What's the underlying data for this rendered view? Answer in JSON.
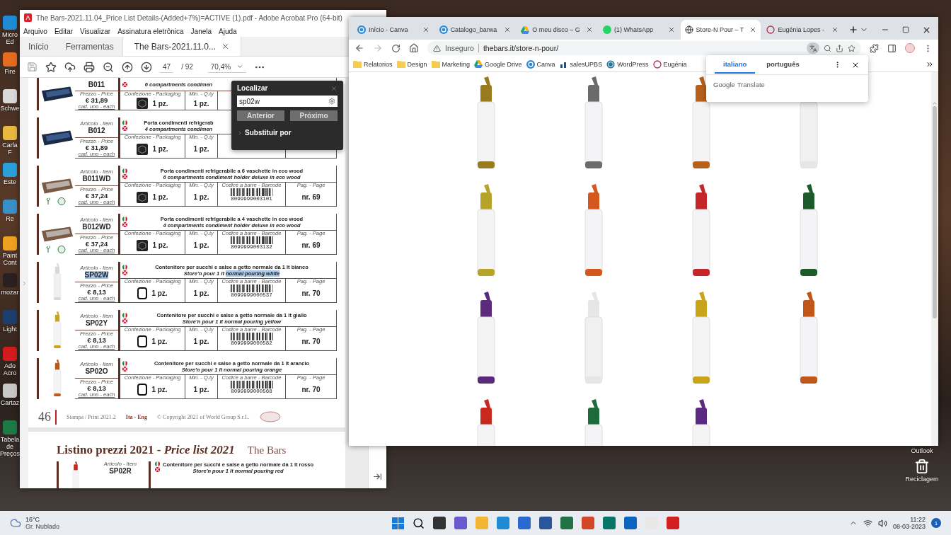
{
  "desktop": {
    "left_icons": [
      {
        "label": "Micro Ed",
        "color": "#1f8ad6"
      },
      {
        "label": "Fire",
        "color": "#e66a1f"
      },
      {
        "label": "Schwe",
        "color": "#d9d9d9"
      },
      {
        "label": "Carla F",
        "color": "#e8b840"
      },
      {
        "label": "Este",
        "color": "#2aa0d8"
      },
      {
        "label": "Re",
        "color": "#3a8fc8"
      },
      {
        "label": "Paint Cont",
        "color": "#f0a020"
      },
      {
        "label": "mozar",
        "color": "#2a2020"
      },
      {
        "label": "Light",
        "color": "#1c3f6e"
      },
      {
        "label": "Ado Acro",
        "color": "#d01c1c"
      },
      {
        "label": "Cartaz",
        "color": "#c8c8c8"
      },
      {
        "label": "Tabela de Preços",
        "color": "#1d7a45"
      }
    ],
    "right_icons": [
      {
        "label": "Outlook",
        "kind": "label"
      },
      {
        "label": "Reciclagem",
        "kind": "bin"
      }
    ]
  },
  "acrobat": {
    "title": "The Bars-2021.11.04_Price List Details-(Added+7%)=ACTIVE (1).pdf - Adobe Acrobat Pro (64-bit)",
    "menu": [
      "Arquivo",
      "Editar",
      "Visualizar",
      "Assinatura eletrônica",
      "Janela",
      "Ajuda"
    ],
    "tabs": [
      {
        "label": "Início",
        "selected": false
      },
      {
        "label": "Ferramentas",
        "selected": false
      },
      {
        "label": "The Bars-2021.11.0...",
        "selected": true
      }
    ],
    "toolbar": {
      "page": "47",
      "pages": "/ 92",
      "zoom": "70,4%"
    },
    "find": {
      "title": "Localizar",
      "value": "sp02w",
      "buttons": [
        "Anterior",
        "Próximo"
      ],
      "replace": "Substituir por"
    },
    "rows": [
      {
        "kind": "tray",
        "code": "B011",
        "code_highlighted": false,
        "price_label": "Prezzo - Price",
        "price": "€ 31,89",
        "each": "cad. uno - each",
        "desc_en": "6 compartments condimen",
        "pack_label": "Confezione - Packaging",
        "pack": "1 pz.",
        "min_label": "Min. - Q.ty",
        "min": "1 pz."
      },
      {
        "kind": "tray",
        "item_label": "Articolo - Item",
        "code": "B012",
        "code_highlighted": false,
        "price_label": "Prezzo - Price",
        "price": "€ 31,89",
        "each": "cad. uno - each",
        "desc_it": "Porta condimenti refrigerab",
        "desc_en": "4 compartments condimen",
        "pack_label": "Confezione - Packaging",
        "pack": "1 pz.",
        "min_label": "Min. - Q.ty",
        "min": "1 pz."
      },
      {
        "kind": "wood-tray",
        "item_label": "Articolo - Item",
        "code": "B011WD",
        "code_highlighted": false,
        "price_label": "Prezzo - Price",
        "price": "€ 37,24",
        "each": "cad. uno - each",
        "desc_it": "Porta condimenti refrigerabile a 6 vaschette in eco wood",
        "desc_en": "6 compartments condiment holder deluxe in eco wood",
        "pack_label": "Confezione - Packaging",
        "pack": "1 pz.",
        "min_label": "Min. - Q.ty",
        "min": "1 pz.",
        "barcode_label": "Codice a barre - Barcode",
        "barcode": "8099999003101",
        "page_label": "Pag. - Page",
        "page": "nr. 69"
      },
      {
        "kind": "wood-tray",
        "item_label": "Articolo - Item",
        "code": "B012WD",
        "code_highlighted": false,
        "price_label": "Prezzo - Price",
        "price": "€ 37,24",
        "each": "cad. uno - each",
        "desc_it": "Porta condimenti refrigerabile a 4 vaschette in eco wood",
        "desc_en": "4 compartments condiment holder deluxe in eco wood",
        "pack_label": "Confezione - Packaging",
        "pack": "1 pz.",
        "min_label": "Min. - Q.ty",
        "min": "1 pz.",
        "barcode_label": "Codice a barre - Barcode",
        "barcode": "8099999003132",
        "page_label": "Pag. - Page",
        "page": "nr. 69"
      },
      {
        "kind": "bottle",
        "color": "#d8d8d8",
        "item_label": "Articolo - Item",
        "code": "SP02W",
        "code_highlighted": true,
        "price_label": "Prezzo - Price",
        "price": "€ 8,13",
        "each": "cad. uno - each",
        "desc_it": "Contenitore per succhi e salse a getto normale da 1 lt bianco",
        "desc_en": "Store'n pour 1 lt",
        "highlight": "normal pouring white",
        "pack_label": "Confezione - Packaging",
        "pack": "1 pz.",
        "min_label": "Min. - Q.ty",
        "min": "1 pz.",
        "barcode_label": "Codice a barre - Barcode",
        "barcode": "8099999000537",
        "page_label": "Pag. - Page",
        "page": "nr. 70"
      },
      {
        "kind": "bottle",
        "color": "#c9a41a",
        "item_label": "Articolo - Item",
        "code": "SP02Y",
        "code_highlighted": false,
        "price_label": "Prezzo - Price",
        "price": "€ 8,13",
        "each": "cad. uno - each",
        "desc_it": "Contenitore per succhi e salse a getto normale da 1 lt giallo",
        "desc_en": "Store'n pour 1 lt normal pouring yellow",
        "pack_label": "Confezione - Packaging",
        "pack": "1 pz.",
        "min_label": "Min. - Q.ty",
        "min": "1 pz.",
        "barcode_label": "Codice a barre - Barcode",
        "barcode": "8099999000582",
        "page_label": "Pag. - Page",
        "page": "nr. 70"
      },
      {
        "kind": "bottle",
        "color": "#c0561a",
        "item_label": "Articolo - Item",
        "code": "SP02O",
        "code_highlighted": false,
        "price_label": "Prezzo - Price",
        "price": "€ 8,13",
        "each": "cad. uno - each",
        "desc_it": "Contenitore per succhi e salse a getto normale da 1 lt arancio",
        "desc_en": "Store'n pour 1 lt normal pouring orange",
        "pack_label": "Confezione - Packaging",
        "pack": "1 pz.",
        "min_label": "Min. - Q.ty",
        "min": "1 pz.",
        "barcode_label": "Codice a barre - Barcode",
        "barcode": "8099999000568",
        "page_label": "Pag. - Page",
        "page": "nr. 70"
      }
    ],
    "footer": {
      "page_number": "46",
      "print": "Stampa / Print 2021.2",
      "lang": "Ita - Eng",
      "copyright": "© Copyright 2021 of World Group S.r.L."
    },
    "next_page": {
      "title": "Listino prezzi 2021 - *Price list 2021*",
      "logo": "The Bars",
      "row": {
        "item_label": "Articolo - Item",
        "code": "SP02R",
        "color": "#c8281e",
        "desc_it": "Contenitore per succhi e salse a getto normale da 1 lt rosso",
        "desc_en": "Store'n pour 1 lt normal pouring red"
      }
    }
  },
  "chrome": {
    "tabs": [
      {
        "label": "Início - Canva",
        "kind": "canva",
        "selected": false
      },
      {
        "label": "Catalogo_barwa",
        "kind": "canva",
        "selected": false
      },
      {
        "label": "O meu disco – G",
        "kind": "drive",
        "selected": false
      },
      {
        "label": "(1) WhatsApp",
        "kind": "whatsapp",
        "selected": false
      },
      {
        "label": "Store-N Pour – T",
        "kind": "globe",
        "selected": true
      },
      {
        "label": "Eugénia Lopes -",
        "kind": "ring",
        "selected": false
      }
    ],
    "security": "Inseguro",
    "url": "thebars.it/store-n-pour/",
    "bookmarks": [
      {
        "label": "Relatorios",
        "kind": "folder"
      },
      {
        "label": "Design",
        "kind": "folder"
      },
      {
        "label": "Marketing",
        "kind": "folder"
      },
      {
        "label": "Google Drive",
        "kind": "drive"
      },
      {
        "label": "Canva",
        "kind": "canva"
      },
      {
        "label": "salesUPBS",
        "kind": "upbs"
      },
      {
        "label": "WordPress",
        "kind": "wordpress"
      },
      {
        "label": "Eugénia",
        "kind": "ring"
      }
    ],
    "translate": {
      "languages": [
        {
          "label": "italiano",
          "selected": true
        },
        {
          "label": "português",
          "selected": false
        }
      ],
      "brand": "Google",
      "product": "Translate"
    },
    "products": [
      {
        "color": "#9a7a1e"
      },
      {
        "color": "#6b6b6b"
      },
      {
        "color": "#b8601a"
      },
      {
        "color": "#e6e6e6"
      },
      {
        "color": "#b5a32a"
      },
      {
        "color": "#d4581e"
      },
      {
        "color": "#c4272a"
      },
      {
        "color": "#1f5a2a"
      },
      {
        "color": "#5b2a7a"
      },
      {
        "color": "#e6e6e6"
      },
      {
        "color": "#c9a41a"
      },
      {
        "color": "#c0561a"
      },
      {
        "color": "#c8281e"
      },
      {
        "color": "#1d6b3a"
      },
      {
        "color": "#5a2a80"
      }
    ]
  },
  "taskbar": {
    "temperature": "16°C",
    "weather": "Gr. Nublado",
    "time": "11:22",
    "date": "08-03-2023",
    "notifications": "1"
  }
}
